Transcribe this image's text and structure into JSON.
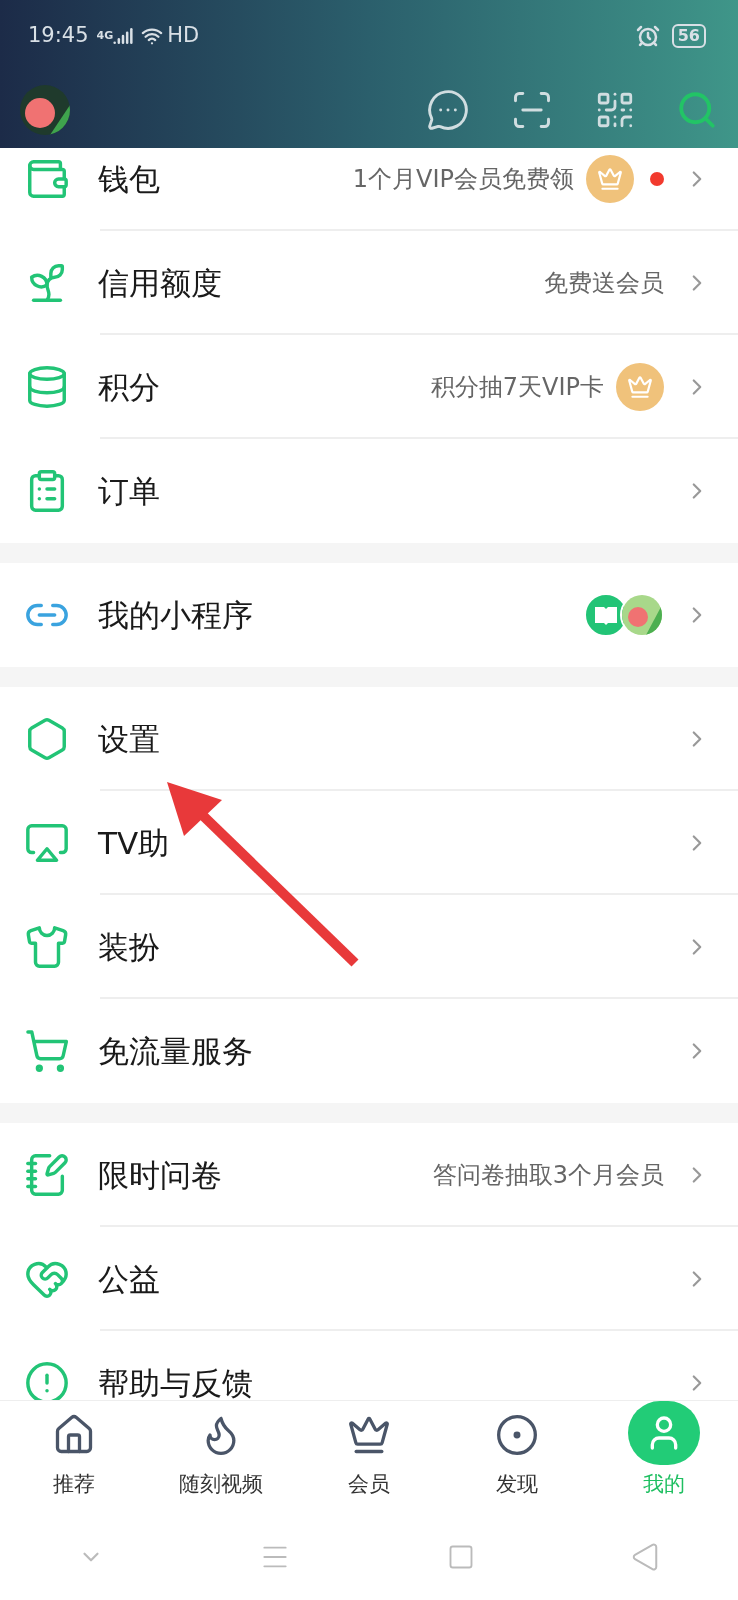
{
  "status_bar": {
    "time": "19:45",
    "network": "4G",
    "wifi_label": "HD",
    "battery": "56"
  },
  "sections": [
    {
      "items": [
        {
          "kind": "crown",
          "label": "钱包",
          "hint": "1个月VIP会员免费领",
          "notification_dot": true
        },
        {
          "kind": "plain",
          "label": "信用额度",
          "hint": "免费送会员"
        },
        {
          "kind": "crown",
          "label": "积分",
          "hint": "积分抽7天VIP卡"
        },
        {
          "kind": "plain",
          "label": "订单"
        }
      ]
    },
    {
      "items": [
        {
          "kind": "apps",
          "label": "我的小程序"
        }
      ]
    },
    {
      "items": [
        {
          "kind": "plain",
          "label": "设置"
        },
        {
          "kind": "plain",
          "label": "TV助"
        },
        {
          "kind": "plain",
          "label": "装扮"
        },
        {
          "kind": "plain",
          "label": "免流量服务"
        }
      ]
    },
    {
      "items": [
        {
          "kind": "plain",
          "label": "限时问卷",
          "hint": "答问卷抽取3个月会员"
        },
        {
          "kind": "plain",
          "label": "公益"
        },
        {
          "kind": "plain",
          "label": "帮助与反馈"
        }
      ]
    }
  ],
  "bottom_nav": [
    {
      "label": "推荐",
      "selected": false
    },
    {
      "label": "随刻视频",
      "selected": false
    },
    {
      "label": "会员",
      "selected": false
    },
    {
      "label": "发现",
      "selected": false
    },
    {
      "label": "我的",
      "selected": true
    }
  ]
}
